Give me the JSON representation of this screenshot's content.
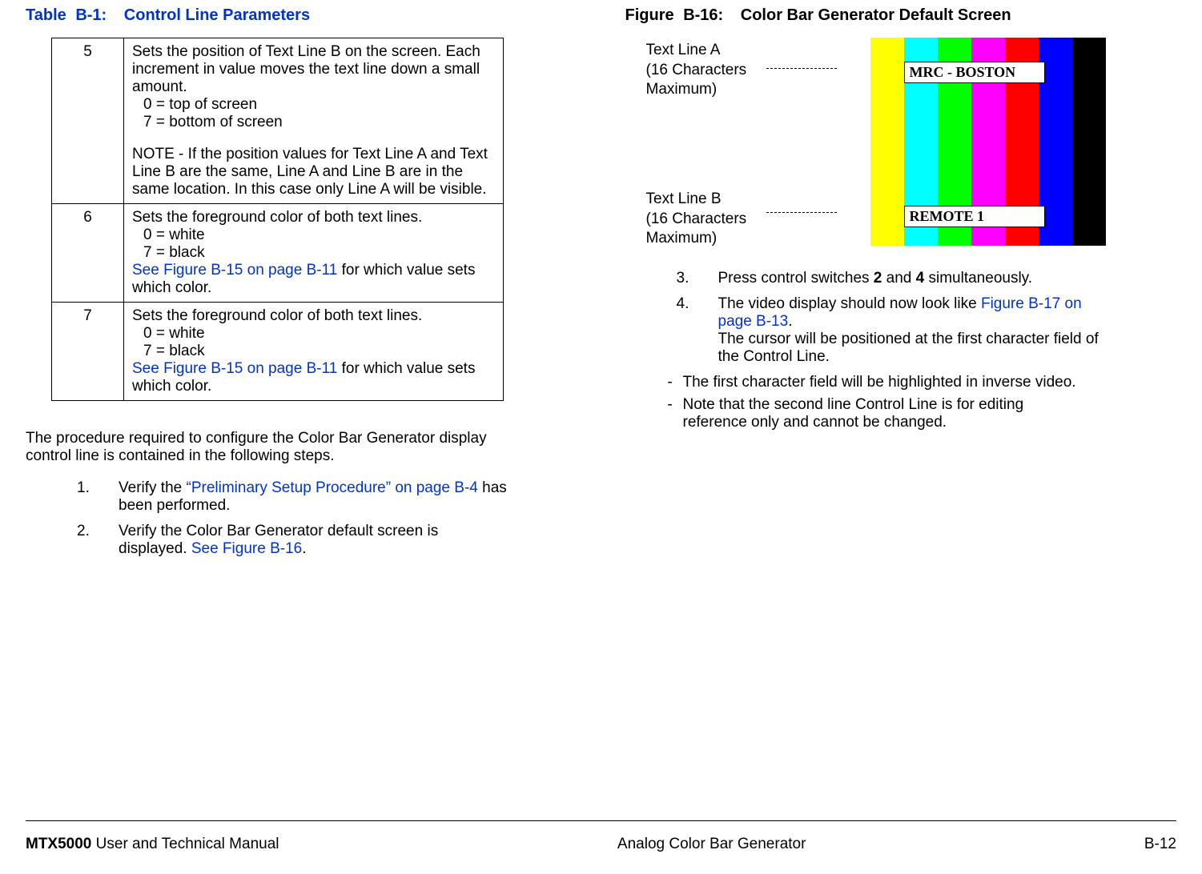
{
  "table": {
    "label_prefix": "Table",
    "number": "B-1:",
    "title": "Control Line Parameters",
    "rows": [
      {
        "num": "5",
        "desc_line1": "Sets the position of Text Line B on the screen.  Each increment in value moves the text line down a small amount.",
        "opt0": "0  =  top of screen",
        "opt7": "7  =  bottom of screen",
        "note": "NOTE - If the position values for Text Line A and Text Line B are the same, Line A and Line B are in the same location.  In this case only Line A will be visible."
      },
      {
        "num": "6",
        "desc_line1": "Sets the foreground color of both text lines.",
        "opt0": "0  =  white",
        "opt7": "7  =  black",
        "link": "See Figure B-15 on page B-11",
        "tail": " for which value sets which color."
      },
      {
        "num": "7",
        "desc_line1": "Sets the foreground color of both text lines.",
        "opt0": "0  =  white",
        "opt7": "7  =  black",
        "link": "See Figure B-15 on page B-11",
        "tail": " for which value sets which color."
      }
    ]
  },
  "intro_para": "The procedure required to configure the Color Bar Generator display control line is contained in the following steps.",
  "left_steps": [
    {
      "n": "1.",
      "pre": "Verify the ",
      "link": "“Preliminary Setup Procedure” on page B-4",
      "post": " has been performed."
    },
    {
      "n": "2.",
      "pre": "Verify the Color Bar Generator default screen is displayed.  ",
      "link": "See Figure B-16",
      "post": "."
    }
  ],
  "figure": {
    "label_prefix": "Figure",
    "number": "B-16:",
    "title": "Color Bar Generator Default Screen",
    "labelA_l1": "Text Line A",
    "labelA_l2": "(16 Characters",
    "labelA_l3": "Maximum)",
    "labelB_l1": "Text Line B",
    "labelB_l2": "(16 Characters",
    "labelB_l3": "Maximum)",
    "overlayA": "MRC - BOSTON",
    "overlayB": "REMOTE 1"
  },
  "right_steps": [
    {
      "n": "3.",
      "pre": "Press control switches ",
      "b1": "2",
      "mid": " and ",
      "b2": "4",
      "post": " simultaneously."
    },
    {
      "n": "4.",
      "pre": "The video display should now look like ",
      "link": "Figure B-17 on page B-13",
      "post": ".",
      "extra": "The cursor will be positioned at the first character field of the Control Line."
    }
  ],
  "right_dashes": [
    "The first character field will be highlighted in inverse video.",
    "Note that the second line Control Line is for editing reference only and cannot be changed."
  ],
  "footer": {
    "product": "MTX5000",
    "left_tail": " User and Technical Manual",
    "center": "Analog Color Bar Generator",
    "right": "B-12"
  }
}
